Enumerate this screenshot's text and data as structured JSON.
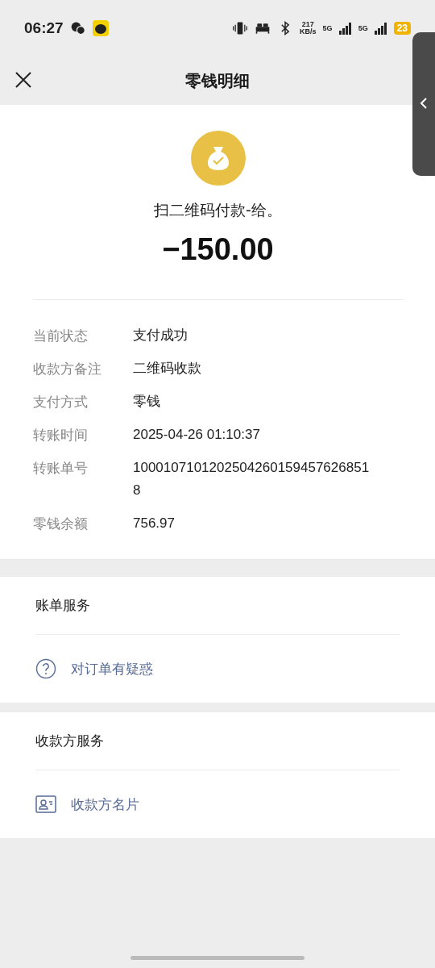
{
  "status_bar": {
    "time": "06:27",
    "speed_value": "217",
    "speed_unit": "KB/s",
    "sim_1": "5G",
    "sim_2": "5G",
    "battery": "23"
  },
  "header": {
    "title": "零钱明细"
  },
  "summary": {
    "description": "扫二维码付款-给。",
    "amount": "−150.00"
  },
  "details": [
    {
      "label": "当前状态",
      "value": "支付成功"
    },
    {
      "label": "收款方备注",
      "value": "二维码收款"
    },
    {
      "label": "支付方式",
      "value": "零钱"
    },
    {
      "label": "转账时间",
      "value": "2025-04-26 01:10:37"
    },
    {
      "label": "转账单号",
      "value": "10001071012025042601594576268518"
    },
    {
      "label": "零钱余额",
      "value": "756.97"
    }
  ],
  "sections": [
    {
      "title": "账单服务",
      "items": [
        {
          "kind": "question",
          "label": "对订单有疑惑"
        }
      ]
    },
    {
      "title": "收款方服务",
      "items": [
        {
          "kind": "card",
          "label": "收款方名片"
        }
      ]
    }
  ]
}
